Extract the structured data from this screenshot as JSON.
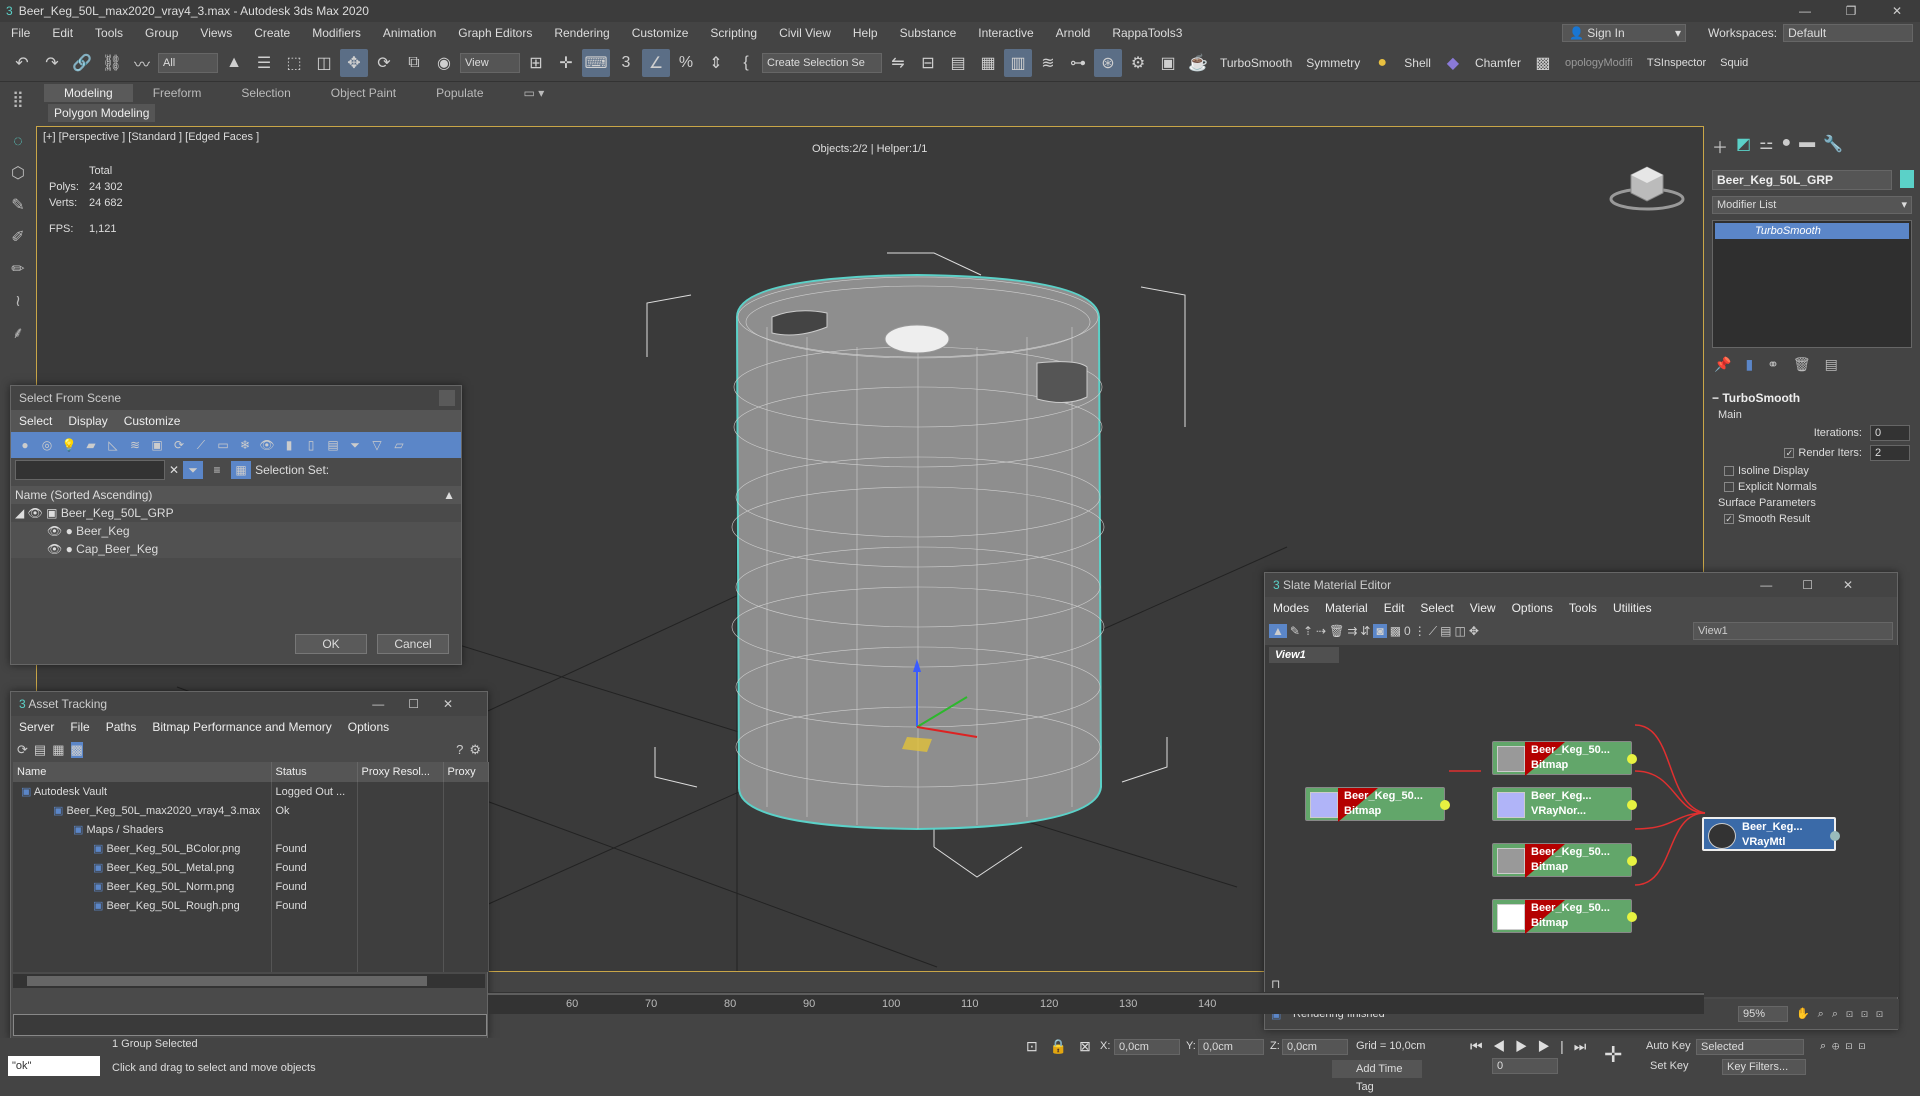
{
  "window": {
    "title": "Beer_Keg_50L_max2020_vray4_3.max - Autodesk 3ds Max 2020",
    "controls": [
      "—",
      "❐",
      "✕"
    ]
  },
  "menu": {
    "items": [
      "File",
      "Edit",
      "Tools",
      "Group",
      "Views",
      "Create",
      "Modifiers",
      "Animation",
      "Graph Editors",
      "Rendering",
      "Customize",
      "Scripting",
      "Civil View",
      "Help",
      "Substance",
      "Interactive",
      "Arnold",
      "RappaTools3"
    ],
    "signin": "Sign In",
    "workspaces_label": "Workspaces:",
    "workspace": "Default"
  },
  "toolbar": {
    "filter": "All",
    "view_dd": "View",
    "create_sel": "Create Selection Se",
    "plugins": [
      "TurboSmooth",
      "Symmetry",
      "Shell",
      "Chamfer",
      "opologyModifi",
      "TSInspector",
      "Squid"
    ]
  },
  "ribbon": {
    "tabs": [
      "Modeling",
      "Freeform",
      "Selection",
      "Object Paint",
      "Populate"
    ],
    "active": "Modeling",
    "sub": "Polygon Modeling"
  },
  "viewport": {
    "label": "[+] [Perspective ] [Standard ] [Edged Faces ]",
    "total": "Total",
    "polys_label": "Polys:",
    "polys": "24 302",
    "verts_label": "Verts:",
    "verts": "24 682",
    "fps_label": "FPS:",
    "fps": "1,121",
    "objects": "Objects:2/2 | Helper:1/1"
  },
  "select_from_scene": {
    "title": "Select From Scene",
    "menu": [
      "Select",
      "Display",
      "Customize"
    ],
    "selection_set": "Selection Set:",
    "col": "Name (Sorted Ascending)",
    "items": [
      "Beer_Keg_50L_GRP",
      "Beer_Keg",
      "Cap_Beer_Keg"
    ],
    "ok": "OK",
    "cancel": "Cancel"
  },
  "asset_tracking": {
    "title": "Asset Tracking",
    "menu": [
      "Server",
      "File",
      "Paths",
      "Bitmap Performance and Memory",
      "Options"
    ],
    "cols": [
      "Name",
      "Status",
      "Proxy Resol...",
      "Proxy"
    ],
    "rows": [
      {
        "name": "Autodesk Vault",
        "status": "Logged Out ..."
      },
      {
        "name": "Beer_Keg_50L_max2020_vray4_3.max",
        "status": "Ok"
      },
      {
        "name": "Maps / Shaders",
        "status": ""
      },
      {
        "name": "Beer_Keg_50L_BColor.png",
        "status": "Found"
      },
      {
        "name": "Beer_Keg_50L_Metal.png",
        "status": "Found"
      },
      {
        "name": "Beer_Keg_50L_Norm.png",
        "status": "Found"
      },
      {
        "name": "Beer_Keg_50L_Rough.png",
        "status": "Found"
      }
    ]
  },
  "command_panel": {
    "object_name": "Beer_Keg_50L_GRP",
    "modifier_list": "Modifier List",
    "stack": [
      "TurboSmooth"
    ],
    "rollout": "TurboSmooth",
    "main": "Main",
    "iterations_label": "Iterations:",
    "iterations": "0",
    "render_iters_label": "Render Iters:",
    "render_iters": "2",
    "isoline": "Isoline Display",
    "explicit": "Explicit Normals",
    "surface": "Surface Parameters",
    "smooth": "Smooth Result"
  },
  "slate": {
    "title": "Slate Material Editor",
    "menu": [
      "Modes",
      "Material",
      "Edit",
      "Select",
      "View",
      "Options",
      "Tools",
      "Utilities"
    ],
    "view_dd": "View1",
    "tab": "View1",
    "status": "Rendering finished",
    "zoom": "95%",
    "nodes": [
      {
        "t1": "Beer_Keg_50...",
        "t2": "Bitmap"
      },
      {
        "t1": "Beer_Keg_50...",
        "t2": "Bitmap"
      },
      {
        "t1": "Beer_Keg...",
        "t2": "VRayNor..."
      },
      {
        "t1": "Beer_Keg_50...",
        "t2": "Bitmap"
      },
      {
        "t1": "Beer_Keg_50...",
        "t2": "Bitmap"
      },
      {
        "t1": "Beer_Keg...",
        "t2": "VRayMtl"
      }
    ]
  },
  "timeline": {
    "ticks": [
      "60",
      "70",
      "80",
      "90",
      "100",
      "110",
      "120",
      "130",
      "140"
    ]
  },
  "status": {
    "script": "\"ok\"",
    "selected": "1 Group Selected",
    "hint": "Click and drag to select and move objects",
    "x_label": "X:",
    "x": "0,0cm",
    "y_label": "Y:",
    "y": "0,0cm",
    "z_label": "Z:",
    "z": "0,0cm",
    "grid": "Grid = 10,0cm",
    "addtime": "Add Time Tag",
    "autokey": "Auto Key",
    "setkey": "Set Key",
    "selected_dd": "Selected",
    "keyfilters": "Key Filters...",
    "frame": "0"
  }
}
